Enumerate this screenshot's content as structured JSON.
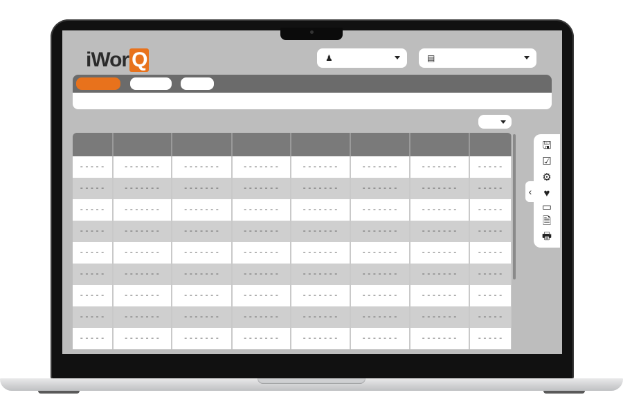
{
  "app": {
    "logo_text_main": "iWor",
    "logo_text_q": "Q"
  },
  "header": {
    "user_icon": "person-icon",
    "list_icon": "list-card-icon"
  },
  "table": {
    "columns": 8,
    "rows": [
      [
        "-----",
        "-------",
        "-------",
        "-------",
        "-------",
        "-------",
        "-------",
        "-----"
      ],
      [
        "-----",
        "-------",
        "-------",
        "-------",
        "-------",
        "-------",
        "-------",
        "-----"
      ],
      [
        "-----",
        "-------",
        "-------",
        "-------",
        "-------",
        "-------",
        "-------",
        "-----"
      ],
      [
        "-----",
        "-------",
        "-------",
        "-------",
        "-------",
        "-------",
        "-------",
        "-----"
      ],
      [
        "-----",
        "-------",
        "-------",
        "-------",
        "-------",
        "-------",
        "-------",
        "-----"
      ],
      [
        "-----",
        "-------",
        "-------",
        "-------",
        "-------",
        "-------",
        "-------",
        "-----"
      ],
      [
        "-----",
        "-------",
        "-------",
        "-------",
        "-------",
        "-------",
        "-------",
        "-----"
      ],
      [
        "-----",
        "-------",
        "-------",
        "-------",
        "-------",
        "-------",
        "-------",
        "-----"
      ],
      [
        "-----",
        "-------",
        "-------",
        "-------",
        "-------",
        "-------",
        "-------",
        "-----"
      ]
    ]
  },
  "toolbar": {
    "icons": [
      "save-icon",
      "checkbox-icon",
      "gears-icon",
      "heart-icon",
      "card-icon",
      "document-icon",
      "print-icon"
    ],
    "collapse_icon": "chevron-left-icon"
  },
  "colors": {
    "accent": "#e8721c",
    "nav": "#6b6b6b",
    "screen_bg": "#bdbdbd"
  }
}
